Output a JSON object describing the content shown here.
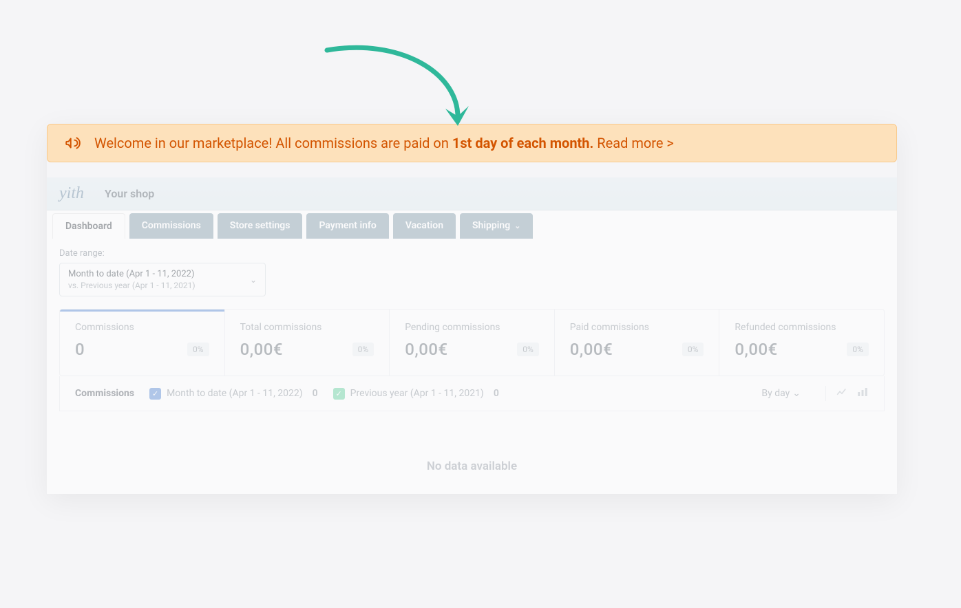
{
  "banner": {
    "text_prefix": "Welcome in our marketplace! All commissions are paid on ",
    "text_bold": "1st day of each month.",
    "read_more": "Read more >"
  },
  "header": {
    "logo": "yith",
    "shop": "Your shop"
  },
  "tabs": [
    {
      "label": "Dashboard",
      "active": true
    },
    {
      "label": "Commissions",
      "active": false
    },
    {
      "label": "Store settings",
      "active": false
    },
    {
      "label": "Payment info",
      "active": false
    },
    {
      "label": "Vacation",
      "active": false
    },
    {
      "label": "Shipping",
      "active": false,
      "chev": true
    }
  ],
  "date_range": {
    "label": "Date range:",
    "main": "Month to date (Apr 1 - 11, 2022)",
    "sub": "vs. Previous year (Apr 1 - 11, 2021)"
  },
  "stats": [
    {
      "title": "Commissions",
      "value": "0",
      "badge": "0%",
      "active": true
    },
    {
      "title": "Total commissions",
      "value": "0,00€",
      "badge": "0%"
    },
    {
      "title": "Pending commissions",
      "value": "0,00€",
      "badge": "0%"
    },
    {
      "title": "Paid commissions",
      "value": "0,00€",
      "badge": "0%"
    },
    {
      "title": "Refunded commissions",
      "value": "0,00€",
      "badge": "0%"
    }
  ],
  "chartbar": {
    "title": "Commissions",
    "legend1": {
      "label": "Month to date (Apr 1 - 11, 2022)",
      "count": "0"
    },
    "legend2": {
      "label": "Previous year (Apr 1 - 11, 2021)",
      "count": "0"
    },
    "byday": "By day"
  },
  "nodata": "No data available"
}
